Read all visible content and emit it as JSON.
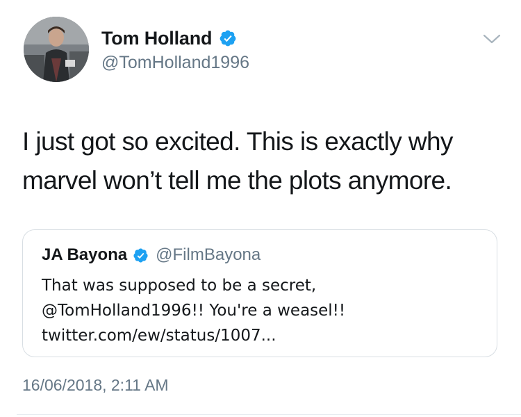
{
  "author": {
    "display_name": "Tom Holland",
    "handle": "@TomHolland1996",
    "verified": true
  },
  "tweet": {
    "text_lines": [
      "I just got so excited. This is exactly why",
      "marvel won’t tell me the plots anymore."
    ],
    "timestamp": "16/06/2018, 2:11 AM"
  },
  "quoted_tweet": {
    "display_name": "JA Bayona",
    "handle": "@FilmBayona",
    "verified": true,
    "text_lines": [
      "That was supposed to be a secret,",
      "@TomHolland1996!! You're a weasel!!",
      "twitter.com/ew/status/1007..."
    ]
  },
  "icons": {
    "verified": "verified-badge-icon",
    "menu": "chevron-down-icon"
  },
  "colors": {
    "text": "#14171a",
    "secondary": "#657786",
    "verified": "#1da1f2",
    "border": "#d8dee3"
  }
}
